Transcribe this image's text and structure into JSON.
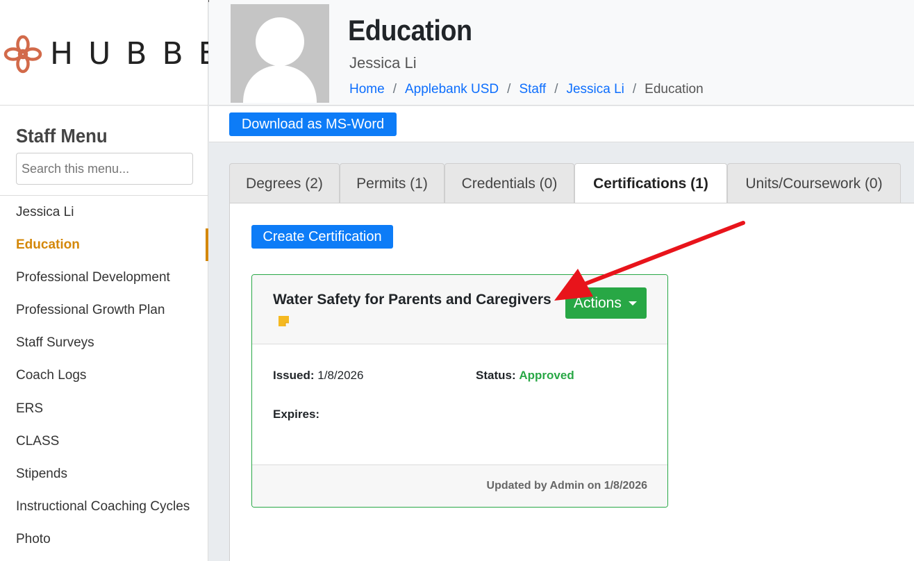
{
  "brand": {
    "logo_text": "HUBBE",
    "accent": "#d4880a",
    "logo_color": "#d26a4a"
  },
  "sidebar": {
    "title": "Staff Menu",
    "search_placeholder": "Search this menu...",
    "items": [
      {
        "label": "Jessica Li"
      },
      {
        "label": "Education",
        "active": true
      },
      {
        "label": "Professional Development"
      },
      {
        "label": "Professional Growth Plan"
      },
      {
        "label": "Staff Surveys"
      },
      {
        "label": "Coach Logs"
      },
      {
        "label": "ERS"
      },
      {
        "label": "CLASS"
      },
      {
        "label": "Stipends"
      },
      {
        "label": "Instructional Coaching Cycles"
      },
      {
        "label": "Photo"
      }
    ]
  },
  "header": {
    "title": "Education",
    "subtitle": "Jessica Li",
    "breadcrumb": [
      "Home",
      "Applebank USD",
      "Staff",
      "Jessica Li",
      "Education"
    ]
  },
  "toolbar": {
    "download_label": "Download as MS-Word"
  },
  "tabs": [
    {
      "label": "Degrees (2)"
    },
    {
      "label": "Permits (1)"
    },
    {
      "label": "Credentials (0)"
    },
    {
      "label": "Certifications (1)",
      "active": true
    },
    {
      "label": "Units/Coursework (0)"
    }
  ],
  "main": {
    "create_label": "Create Certification",
    "card": {
      "title": "Water Safety for Parents and Caregivers",
      "actions_label": "Actions",
      "issued_label": "Issued:",
      "issued_value": "1/8/2026",
      "status_label": "Status:",
      "status_value": "Approved",
      "expires_label": "Expires:",
      "expires_value": "",
      "updated_text": "Updated by Admin on 1/8/2026"
    }
  },
  "colors": {
    "primary": "#0d7cf7",
    "success": "#28a745",
    "annotation_arrow": "#e8141b"
  }
}
